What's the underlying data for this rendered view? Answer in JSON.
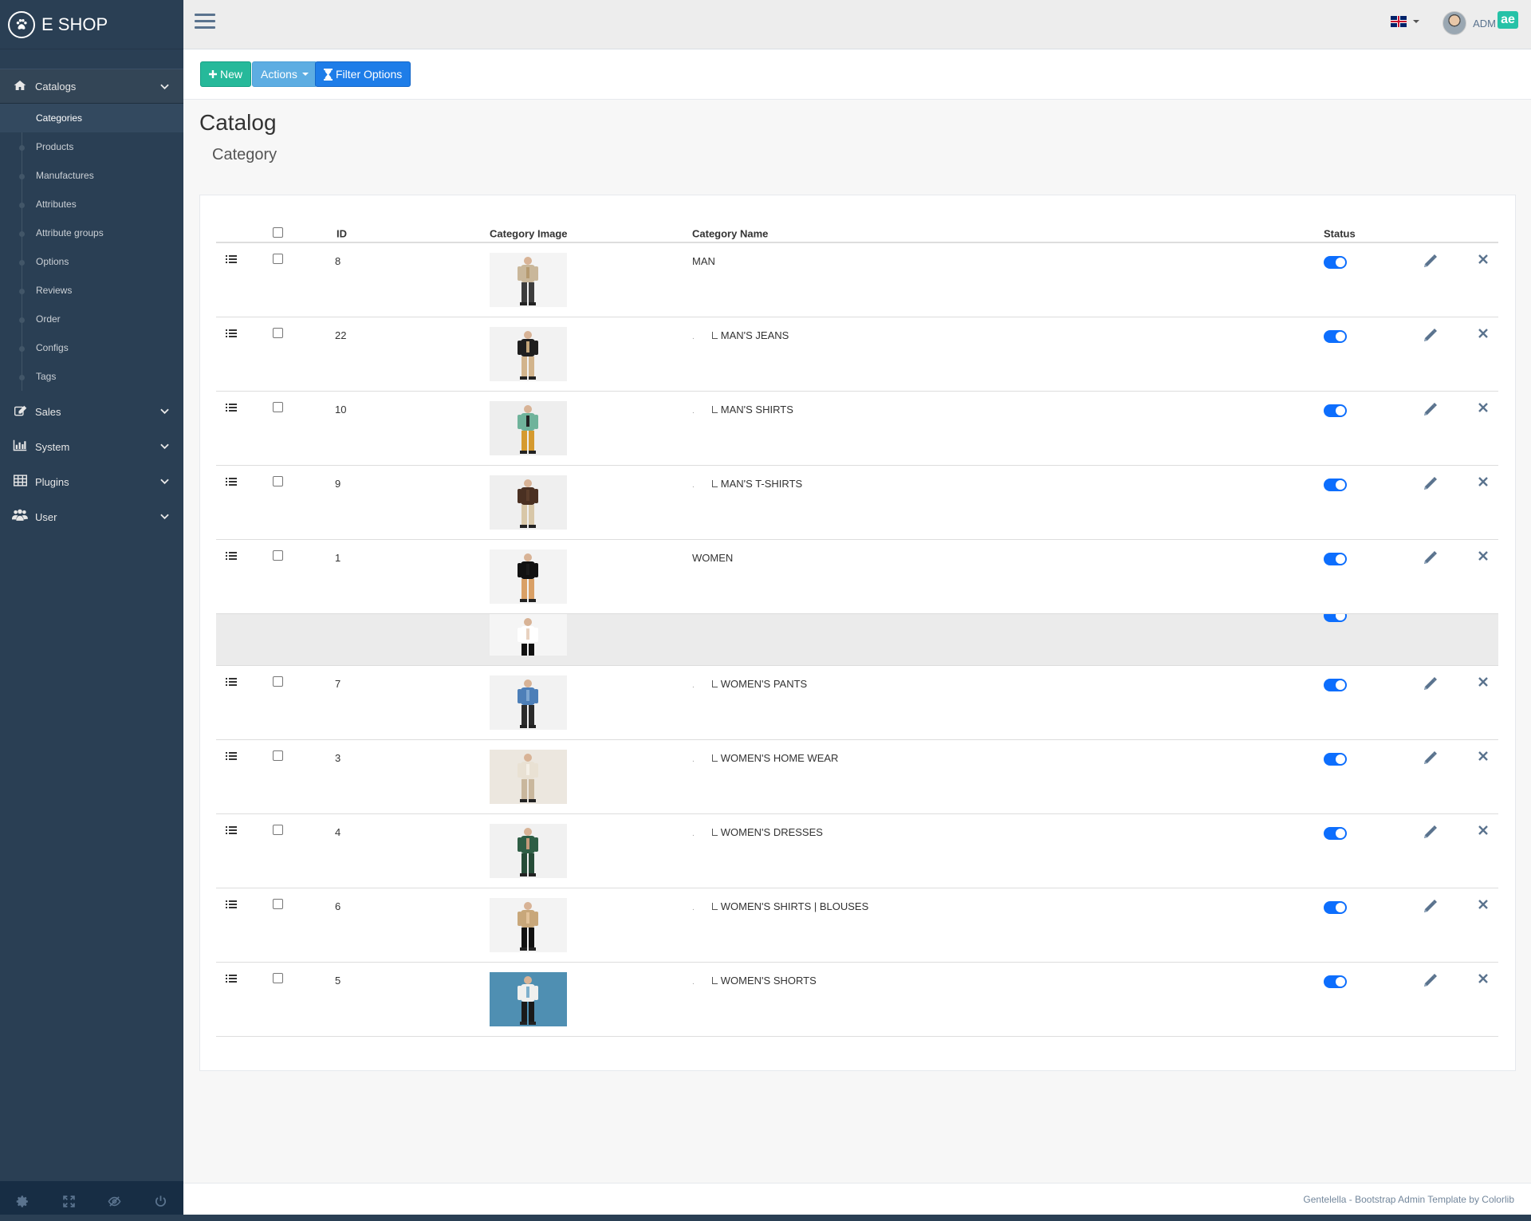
{
  "brand": {
    "title": "E SHOP",
    "logo_icon": "paw-icon"
  },
  "sidebar": {
    "groups": [
      {
        "label": "Catalogs",
        "icon": "home-icon",
        "expanded": true
      },
      {
        "label": "Sales",
        "icon": "edit-icon",
        "expanded": false
      },
      {
        "label": "System",
        "icon": "bar-chart-icon",
        "expanded": false
      },
      {
        "label": "Plugins",
        "icon": "table-icon",
        "expanded": false
      },
      {
        "label": "User",
        "icon": "users-icon",
        "expanded": false
      }
    ],
    "catalog_items": [
      {
        "label": "Categories",
        "active": true
      },
      {
        "label": "Products"
      },
      {
        "label": "Manufactures"
      },
      {
        "label": "Attributes"
      },
      {
        "label": "Attribute groups"
      },
      {
        "label": "Options"
      },
      {
        "label": "Reviews"
      },
      {
        "label": "Order"
      },
      {
        "label": "Configs"
      },
      {
        "label": "Tags"
      }
    ],
    "footer_icons": [
      "settings-icon",
      "fullscreen-icon",
      "eye-slash-icon",
      "power-icon"
    ]
  },
  "topbar": {
    "user_name": "ADM",
    "badge": "ae",
    "language": "en-gb-flag"
  },
  "toolbar": {
    "new_label": "New",
    "actions_label": "Actions",
    "filter_label": "Filter Options"
  },
  "page": {
    "title": "Catalog",
    "subtitle": "Category"
  },
  "table": {
    "headers": {
      "id": "ID",
      "image": "Category Image",
      "name": "Category Name",
      "status": "Status"
    },
    "rows": [
      {
        "id": "8",
        "name": "MAN",
        "child": false,
        "status": true,
        "img": [
          "#f4f4f4",
          "#c9b79a",
          "#3d3d3d",
          "#b59a70"
        ]
      },
      {
        "id": "22",
        "name": "MAN'S JEANS",
        "child": true,
        "status": true,
        "img": [
          "#f2f2f2",
          "#1f1f1f",
          "#d2b48c",
          "#c4a67a"
        ]
      },
      {
        "id": "10",
        "name": "MAN'S SHIRTS",
        "child": true,
        "status": true,
        "img": [
          "#eeeeee",
          "#6fb39b",
          "#d59a2f",
          "#222222"
        ]
      },
      {
        "id": "9",
        "name": "MAN'S T-SHIRTS",
        "child": true,
        "status": true,
        "img": [
          "#efefef",
          "#4a3022",
          "#d8c7a8",
          "#5b3d2b"
        ]
      },
      {
        "id": "1",
        "name": "WOMEN",
        "child": false,
        "status": true,
        "img": [
          "#f3f3f3",
          "#111111",
          "#d9a066",
          "#1a1a1a"
        ]
      }
    ],
    "ghost_row": {
      "img": [
        "#f5f5f5",
        "#ffffff",
        "#111111",
        "#e8d2c0"
      ]
    },
    "rows_after": [
      {
        "id": "7",
        "name": "WOMEN'S PANTS",
        "child": true,
        "status": true,
        "img": [
          "#f2f2f2",
          "#4d7fb8",
          "#2b2b2b",
          "#7ea7d1"
        ]
      },
      {
        "id": "3",
        "name": "WOMEN'S HOME WEAR",
        "child": true,
        "status": true,
        "img": [
          "#ece7df",
          "#e9e1d3",
          "#c9b79d",
          "#f4efe6"
        ]
      },
      {
        "id": "4",
        "name": "WOMEN'S DRESSES",
        "child": true,
        "status": true,
        "img": [
          "#f1f1f1",
          "#2e5e45",
          "#264c38",
          "#c49a7a"
        ]
      },
      {
        "id": "6",
        "name": "WOMEN'S SHIRTS | BLOUSES",
        "child": true,
        "status": true,
        "img": [
          "#f3f3f3",
          "#c8a77a",
          "#111111",
          "#e2c29a"
        ]
      },
      {
        "id": "5",
        "name": "WOMEN'S SHORTS",
        "child": true,
        "status": true,
        "img": [
          "#4f8fb2",
          "#f0f0ee",
          "#1a1a1a",
          "#7fb0cc"
        ]
      }
    ]
  },
  "footer": {
    "text": "Gentelella - Bootstrap Admin Template by Colorlib"
  },
  "colors": {
    "sidebar": "#2A3F54",
    "new_btn": "#26B99A",
    "actions_btn": "#5DADE2",
    "filter_btn": "#1E7DE8",
    "toggle": "#0D6EFD"
  }
}
